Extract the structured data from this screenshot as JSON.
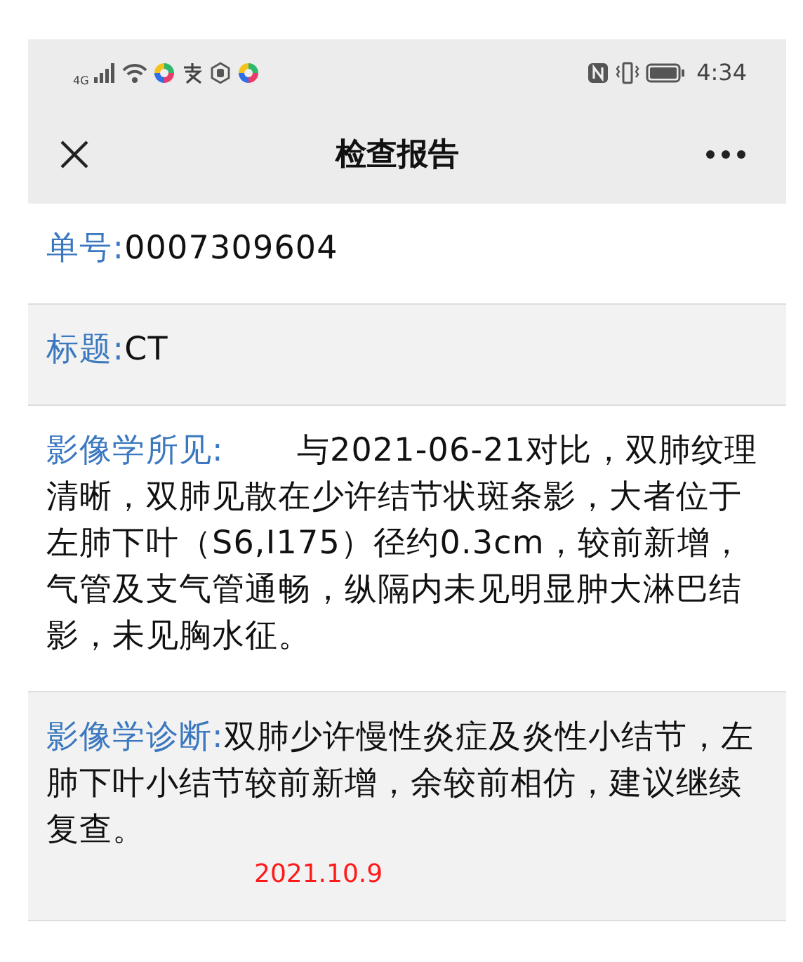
{
  "status_bar": {
    "network": "4G",
    "time": "4:34"
  },
  "nav_bar": {
    "title": "检查报告"
  },
  "fields": [
    {
      "label": "单号:",
      "value": "0007309604",
      "gap": false
    },
    {
      "label": "标题:",
      "value": "CT",
      "gap": false
    },
    {
      "label": "影像学所见:",
      "value": "与2021-06-21对比，双肺纹理清晰，双肺见散在少许结节状斑条影，大者位于左肺下叶（S6,I175）径约0.3cm，较前新增，气管及支气管通畅，纵隔内未见明显肿大淋巴结影，未见胸水征。",
      "gap": true
    },
    {
      "label": "影像学诊断:",
      "value": "双肺少许慢性炎症及炎性小结节，左肺下叶小结节较前新增，余较前相仿，建议继续复查。",
      "gap": false
    }
  ],
  "annotation": "2021.10.9"
}
